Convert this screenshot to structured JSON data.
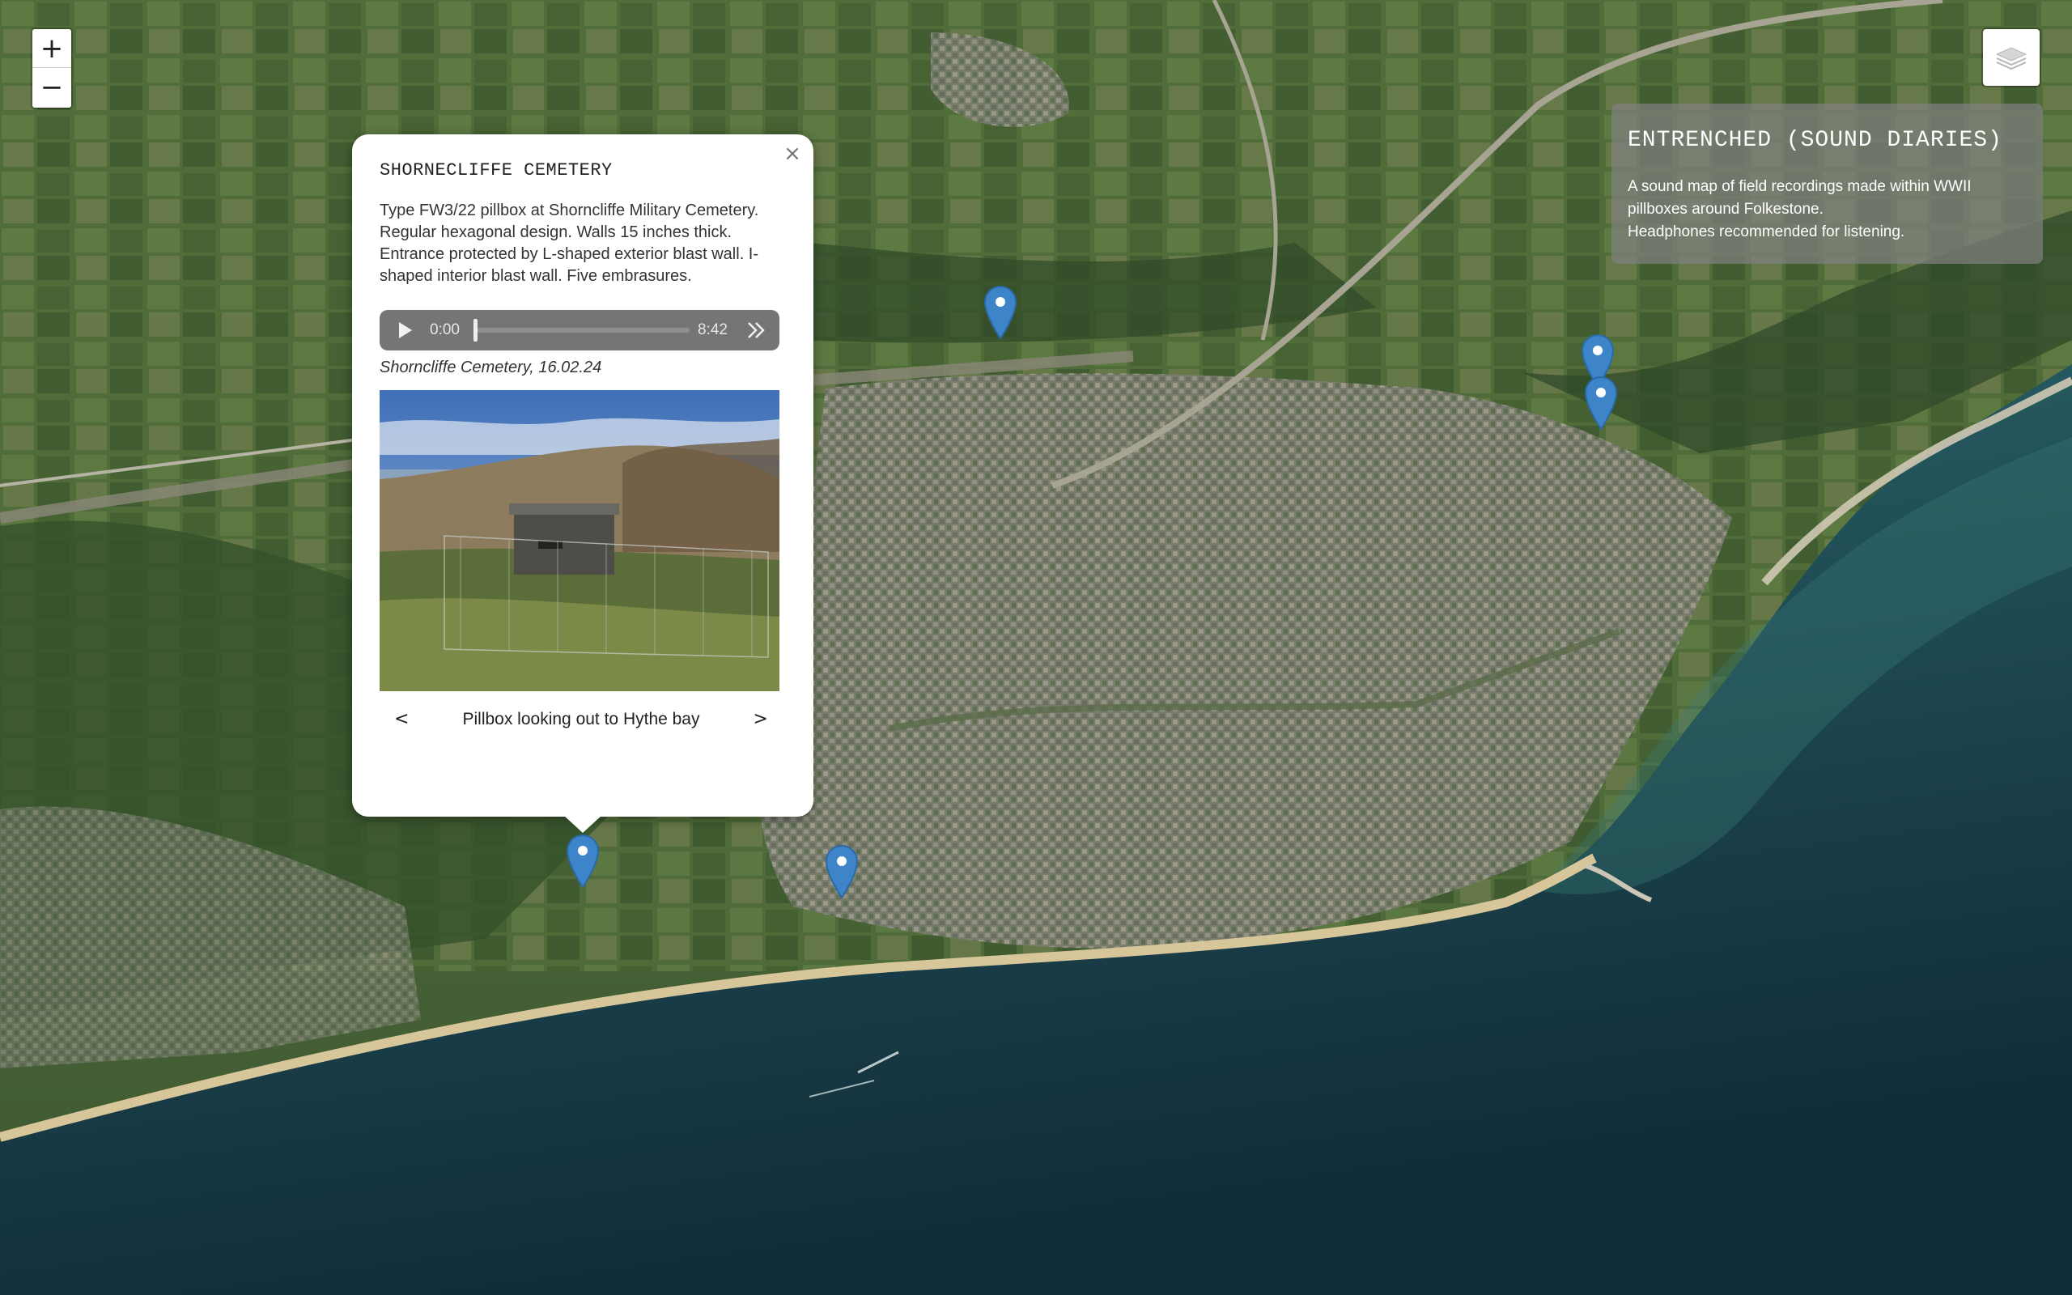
{
  "map": {
    "zoom_in_label": "+",
    "zoom_out_label": "−",
    "layers_icon": "layers-icon",
    "colors": {
      "sea_deep": "#173a44",
      "sea_shallow": "#2f6c6c",
      "beach": "#d8c69b",
      "town": "#8c8a80",
      "field": "#4f6b3a",
      "marker": "#3d84c9"
    }
  },
  "info_panel": {
    "title": "ENTRENCHED (SOUND DIARIES)",
    "line1": "A sound map of field recordings made within WWII pillboxes around Folkestone.",
    "line2": "Headphones recommended for listening."
  },
  "popup": {
    "close_label": "×",
    "title": "SHORNECLIFFE CEMETERY",
    "description": "Type FW3/22 pillbox at Shorncliffe Military Cemetery. Regular hexagonal design. Walls 15 inches thick. Entrance protected by L-shaped exterior blast wall. I-shaped interior blast wall. Five embrasures.",
    "audio": {
      "current_time": "0:00",
      "duration": "8:42",
      "progress": 0
    },
    "caption": "Shorncliffe Cemetery, 16.02.24",
    "photo_caption": "Pillbox looking out to Hythe bay",
    "prev_label": "<",
    "next_label": ">"
  },
  "markers": [
    {
      "name": "pillbox-marker-1"
    },
    {
      "name": "pillbox-marker-2"
    },
    {
      "name": "pillbox-marker-3"
    },
    {
      "name": "pillbox-marker-4"
    },
    {
      "name": "pillbox-marker-5"
    }
  ]
}
